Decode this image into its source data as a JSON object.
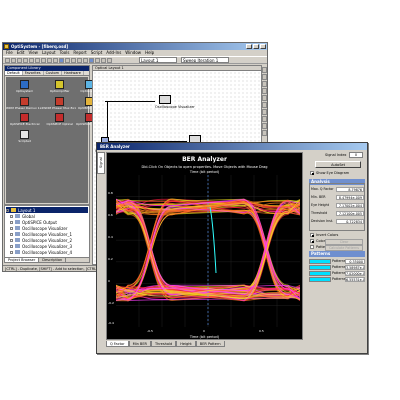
{
  "main_window": {
    "title": "OptiSystem - [fiberq.osd]",
    "menu": [
      "File",
      "Edit",
      "View",
      "Layout",
      "Tools",
      "Report",
      "Script",
      "Add-Ins",
      "Window",
      "Help"
    ],
    "layout_select": "Layout 1",
    "sweep_select": "Sweep Iteration 1",
    "status": "[CTRL] - Duplicate, [SHIFT] - Add to selection, [CTRL + SHIFT]"
  },
  "component_library": {
    "title": "Component Library",
    "tabs": [
      "Default",
      "Favorites",
      "Custom",
      "Hardware"
    ],
    "items": [
      {
        "label": "Optisystem",
        "color": "#2c6cc4"
      },
      {
        "label": "OptiAmplifier",
        "color": "#d4c42c"
      },
      {
        "label": "OptiGrating",
        "color": "#5cb4e4"
      },
      {
        "label": "",
        "color": "#6f6f6f"
      },
      {
        "label": "WDM Phaser Demux 1x2",
        "color": "#c43c2c"
      },
      {
        "label": "WDM Phaser Mux 8x1",
        "color": "#c43c2c"
      },
      {
        "label": "OptiBPM Comp",
        "color": "#e4b43c"
      },
      {
        "label": "",
        "color": "#6f6f6f"
      },
      {
        "label": "OptiSPICE Electrical",
        "color": "#c42c2c"
      },
      {
        "label": "OptiSPICE Optical",
        "color": "#c42c2c"
      },
      {
        "label": "OptiSPICE Output",
        "color": "#c42c2c"
      },
      {
        "label": "",
        "color": "#6f6f6f"
      },
      {
        "label": "Scripted",
        "color": "#e4e4e4"
      }
    ]
  },
  "project_browser": {
    "tree": [
      {
        "label": "Layout 1",
        "level": 0,
        "selected": true
      },
      {
        "label": "Global",
        "level": 1
      },
      {
        "label": "OptiSPICE Output",
        "level": 1
      },
      {
        "label": "Oscilloscope Visualizer",
        "level": 1
      },
      {
        "label": "Oscilloscope Visualizer_1",
        "level": 1
      },
      {
        "label": "Oscilloscope Visualizer_2",
        "level": 1
      },
      {
        "label": "Oscilloscope Visualizer_3",
        "level": 1
      },
      {
        "label": "Oscilloscope Visualizer_4",
        "level": 1
      }
    ],
    "tabs": [
      "Project Browser",
      "Description"
    ]
  },
  "layout": {
    "title": "Optical Layout 1",
    "components": [
      {
        "label": "Oscilloscope Visualizer"
      },
      {
        "label": "Oscilloscope Visualizer_1"
      },
      {
        "label": "Oscilloscope Visualizer_2"
      },
      {
        "label": "Oscilloscope Visualizer_4"
      },
      {
        "label": "OptiSPICE Output"
      }
    ]
  },
  "ber_analyzer": {
    "window_title": "BER Analyzer",
    "side_tab": "Signal",
    "plot_title": "BER Analyzer",
    "plot_hint": "Dbl-Click On Objects to open properties.  Move Objects with Mouse Drag",
    "x_label": "Time (bit period)",
    "y_ticks": [
      "0.8",
      "0.6",
      "0.4",
      "0.2",
      "0",
      "-0.2",
      "-0.4"
    ],
    "x_ticks": [
      "-0.5",
      "0",
      "0.5"
    ],
    "bottom_tabs": [
      "Q Factor",
      "Min BER",
      "Threshold",
      "Height",
      "BER Pattern"
    ],
    "signal_index_label": "Signal Index",
    "signal_index": "0",
    "autoset_label": "AutoSet",
    "show_eye_label": "Show Eye Diagram",
    "analysis": {
      "title": "Analysis",
      "rows": [
        {
          "label": "Max. Q Factor",
          "value": "8.79876"
        },
        {
          "label": "Min. BER",
          "value": "8.47994e-009"
        },
        {
          "label": "Eye Height",
          "value": "7.17002e-004"
        },
        {
          "label": "Threshold",
          "value": "7.12100e-005"
        },
        {
          "label": "Decision Inst.",
          "value": "0.722834"
        }
      ]
    },
    "controls": {
      "invert_colors": "Invert Colors",
      "color_grade": "Color Grade",
      "patterns_check": "Patterns",
      "clear_btn": "Clear",
      "calculate_btn": "Calculate Patterns"
    },
    "patterns": {
      "title": "Patterns",
      "rows": [
        {
          "label": "Patterns 1",
          "value": "0.35000",
          "color": "#00e0ff"
        },
        {
          "label": "Patterns 2",
          "value": "3.58987e-001",
          "color": "#00e0ff"
        },
        {
          "label": "Patterns 3",
          "value": "7.02000e-004",
          "color": "#00e0ff"
        },
        {
          "label": "Patterns 4",
          "value": "6.55531e-004",
          "color": "#00e0ff"
        }
      ]
    }
  },
  "colors": {
    "titlebar_start": "#0a246a",
    "eye_yellow": "#f0e020",
    "eye_red": "#ff2040",
    "eye_pink": "#ff40ff",
    "eye_cyan": "#30ffff"
  }
}
